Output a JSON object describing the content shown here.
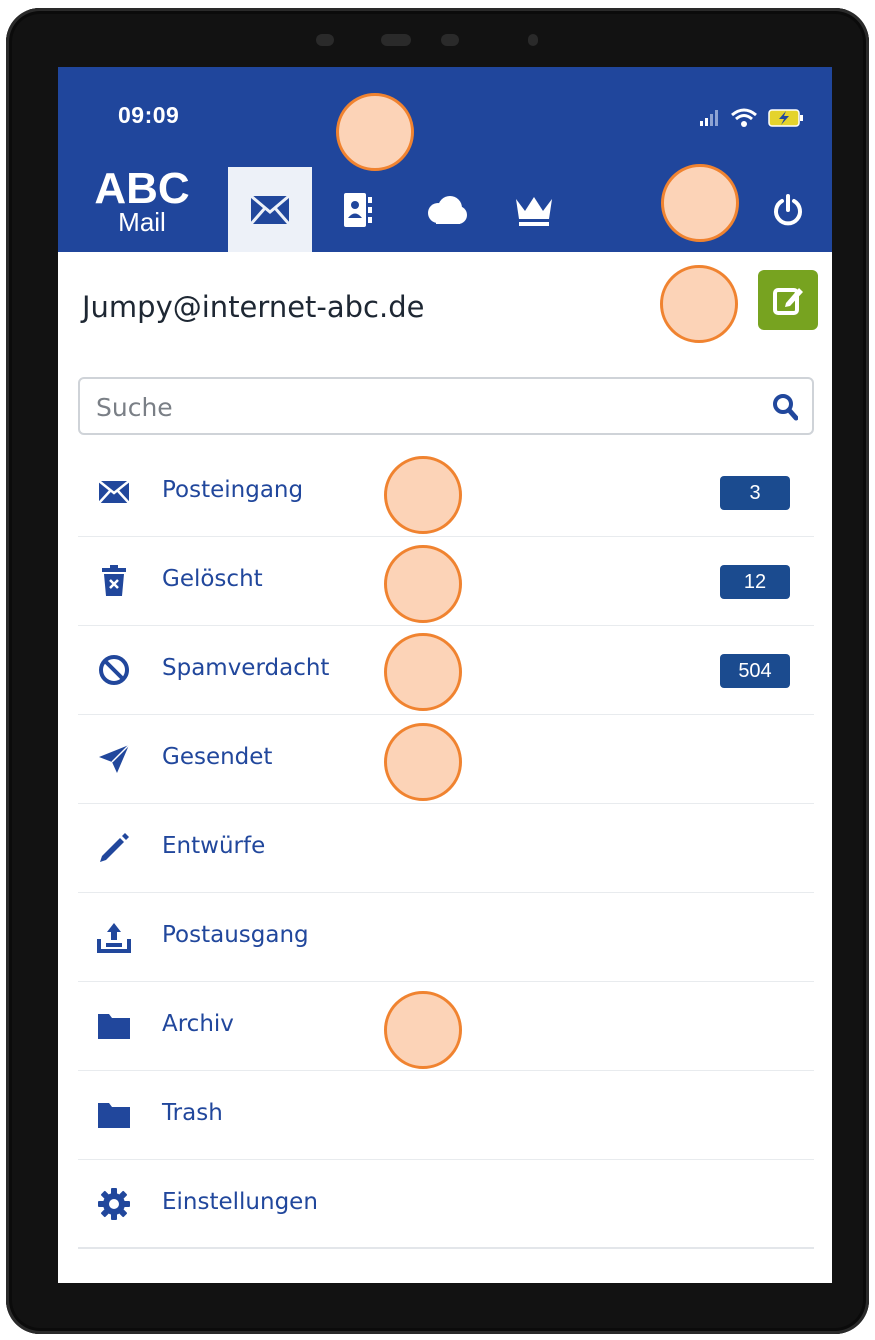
{
  "status_bar": {
    "time": "09:09"
  },
  "header": {
    "logo_title": "ABC",
    "logo_subtitle": "Mail",
    "tabs": [
      {
        "icon": "envelope-icon",
        "active": true
      },
      {
        "icon": "contacts-icon",
        "active": false
      },
      {
        "icon": "cloud-icon",
        "active": false
      },
      {
        "icon": "crown-icon",
        "active": false
      }
    ],
    "power_icon": "power-icon"
  },
  "account": {
    "email": "Jumpy@internet-abc.de",
    "compose_icon": "compose-icon"
  },
  "search": {
    "placeholder": "Suche",
    "value": ""
  },
  "folders": [
    {
      "label": "Posteingang",
      "icon": "envelope-icon",
      "count": "3"
    },
    {
      "label": "Gelöscht",
      "icon": "trash-icon",
      "count": "12"
    },
    {
      "label": "Spamverdacht",
      "icon": "ban-icon",
      "count": "504"
    },
    {
      "label": "Gesendet",
      "icon": "send-icon"
    },
    {
      "label": "Entwürfe",
      "icon": "pencil-icon"
    },
    {
      "label": "Postausgang",
      "icon": "outbox-icon"
    },
    {
      "label": "Archiv",
      "icon": "folder-icon"
    },
    {
      "label": "Trash",
      "icon": "folder-icon"
    },
    {
      "label": "Einstellungen",
      "icon": "gear-icon"
    }
  ],
  "colors": {
    "header_bg": "#20469c",
    "link_blue": "#21479c",
    "badge_bg": "#1b4b8f",
    "compose_green": "#77a320",
    "marker_fill": "#fcd3b7",
    "marker_border": "#f08330"
  }
}
